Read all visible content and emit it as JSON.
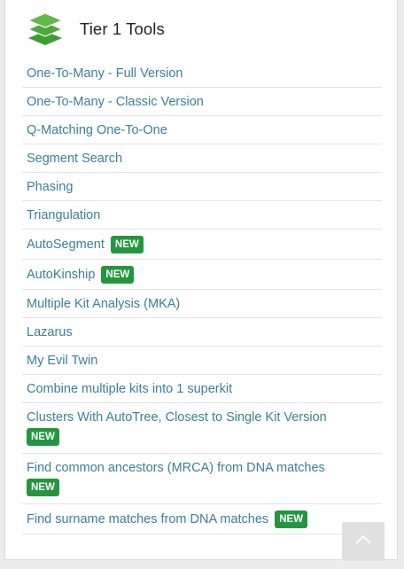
{
  "panel": {
    "title": "Tier 1 Tools",
    "icon": "layers-icon",
    "accent_color": "#5aaa3c"
  },
  "tools": [
    {
      "label": "One-To-Many - Full Version"
    },
    {
      "label": "One-To-Many - Classic Version"
    },
    {
      "label": "Q-Matching One-To-One"
    },
    {
      "label": "Segment Search"
    },
    {
      "label": "Phasing"
    },
    {
      "label": "Triangulation"
    },
    {
      "label": "AutoSegment",
      "badge": "NEW"
    },
    {
      "label": "AutoKinship",
      "badge": "NEW"
    },
    {
      "label": "Multiple Kit Analysis (MKA)"
    },
    {
      "label": "Lazarus"
    },
    {
      "label": "My Evil Twin"
    },
    {
      "label": "Combine multiple kits into 1 superkit"
    },
    {
      "label": "Clusters With AutoTree, Closest to Single Kit Version",
      "badge": "NEW"
    },
    {
      "label": "Find common ancestors (MRCA) from DNA matches",
      "badge": "NEW"
    },
    {
      "label": "Find surname matches from DNA matches",
      "badge": "NEW"
    }
  ],
  "badge_color": "#23963f",
  "link_color": "#3b7f97",
  "scroll_top": {
    "icon": "chevron-up-icon"
  }
}
